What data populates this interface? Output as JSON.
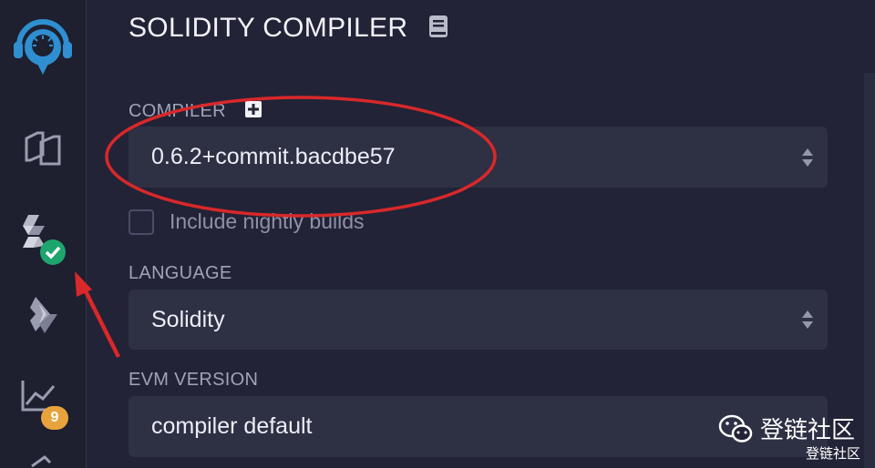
{
  "sidebar": {
    "items": [
      {
        "icon": "remix-logo-icon"
      },
      {
        "icon": "file-explorer-icon"
      },
      {
        "icon": "solidity-compiler-icon",
        "status": "check-badge-icon"
      },
      {
        "icon": "deploy-run-icon"
      },
      {
        "icon": "analytics-icon",
        "badge": "9"
      },
      {
        "icon": "debugger-icon"
      }
    ]
  },
  "main": {
    "title": "SOLIDITY COMPILER",
    "title_icon": "book-icon",
    "compiler_label": "COMPILER",
    "compiler_add_icon": "plus-square-icon",
    "compiler_value": "0.6.2+commit.bacdbe57",
    "nightly_label": "Include nightly builds",
    "nightly_checked": false,
    "language_label": "LANGUAGE",
    "language_value": "Solidity",
    "evm_label": "EVM VERSION",
    "evm_value": "compiler default"
  },
  "watermark": {
    "text": "登链社区",
    "small_text": "登链社区",
    "icon": "wechat-icon"
  },
  "annotations": {
    "ellipse_color": "#d9282a",
    "arrow_color": "#d9282a"
  }
}
